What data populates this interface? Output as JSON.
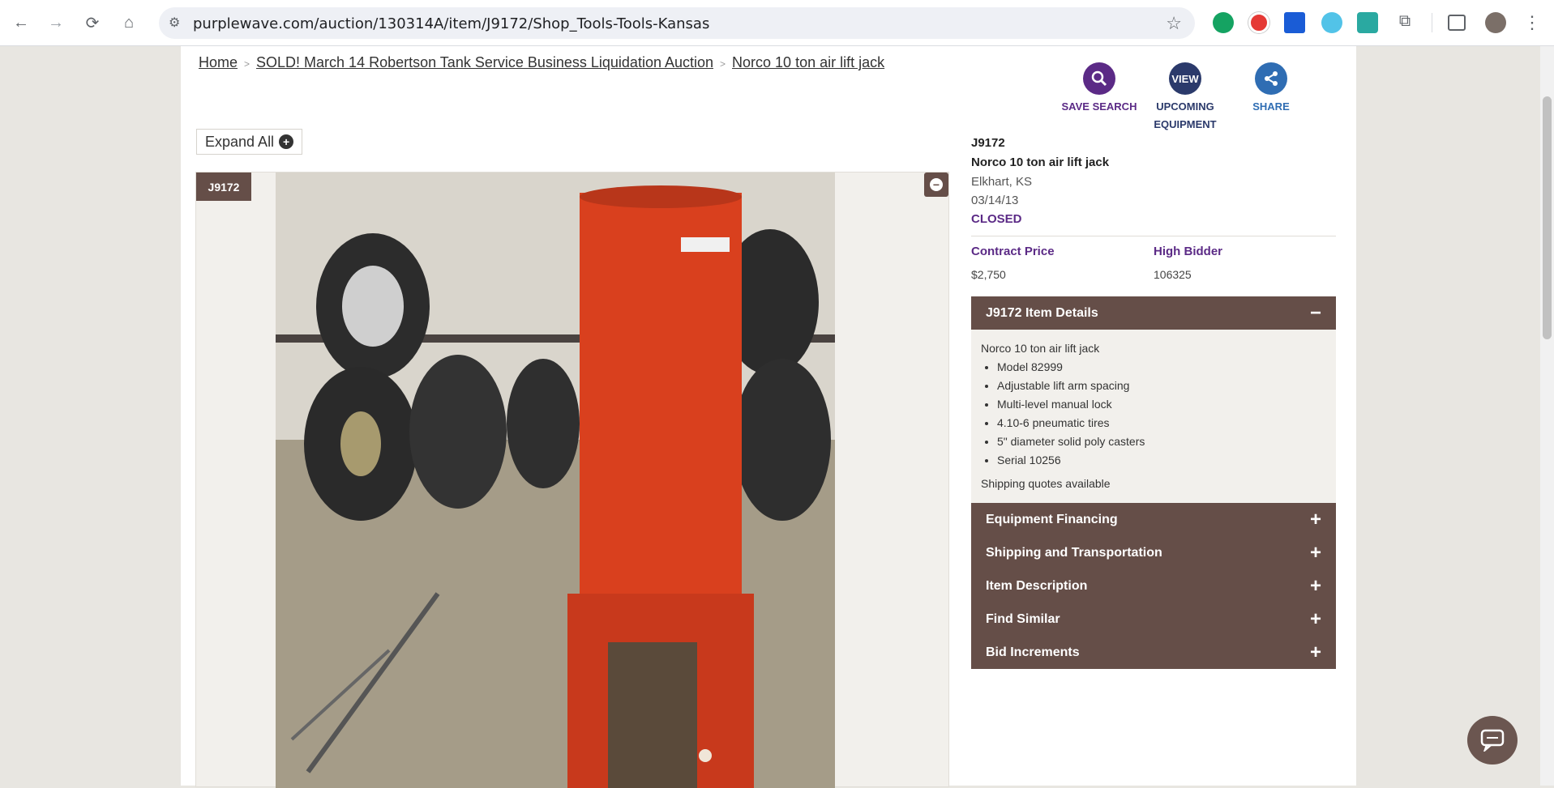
{
  "browser": {
    "url": "purplewave.com/auction/130314A/item/J9172/Shop_Tools-Tools-Kansas"
  },
  "breadcrumb": {
    "home": "Home",
    "auction": "SOLD! March 14 Robertson Tank Service Business Liquidation Auction",
    "item": "Norco 10 ton air lift jack",
    "separator": ">"
  },
  "actions": {
    "save_search": "SAVE SEARCH",
    "view_label": "VIEW",
    "upcoming": "UPCOMING",
    "equipment": "EQUIPMENT",
    "share": "SHARE"
  },
  "expand_all": "Expand All",
  "photo_tag": "J9172",
  "item": {
    "id": "J9172",
    "title": "Norco 10 ton air lift jack",
    "location": "Elkhart, KS",
    "date": "03/14/13",
    "status": "CLOSED",
    "contract_price_label": "Contract Price",
    "contract_price": "$2,750",
    "high_bidder_label": "High Bidder",
    "high_bidder": "106325"
  },
  "details": {
    "header": "J9172 Item Details",
    "intro": "Norco 10 ton air lift jack",
    "bullets": [
      "Model 82999",
      "Adjustable lift arm spacing",
      "Multi-level manual lock",
      "4.10-6 pneumatic tires",
      "5\" diameter solid poly casters",
      "Serial 10256"
    ],
    "shipping": "Shipping quotes available"
  },
  "accordions": [
    "Equipment Financing",
    "Shipping and Transportation",
    "Item Description",
    "Find Similar",
    "Bid Increments"
  ],
  "colors": {
    "brand_brown": "#654e48",
    "brand_purple": "#5b2a86",
    "share_blue": "#2f6db3",
    "view_navy": "#2b3a6b"
  }
}
